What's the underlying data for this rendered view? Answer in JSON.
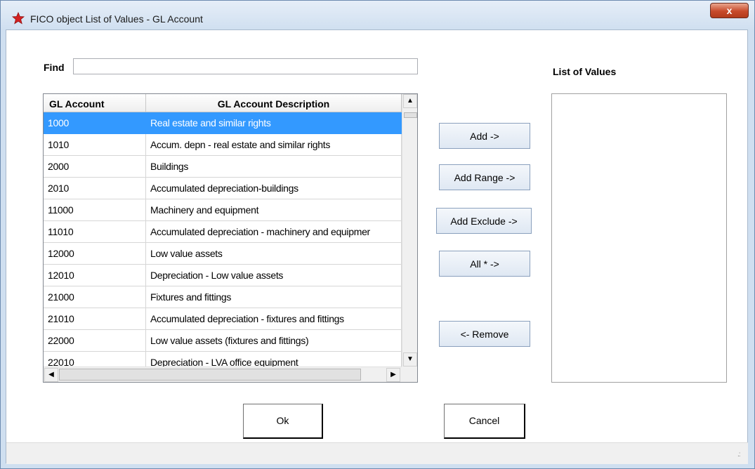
{
  "window": {
    "title": "FICO object List of Values - GL Account",
    "close_label": "x"
  },
  "find": {
    "label": "Find",
    "value": ""
  },
  "grid": {
    "columns": [
      "GL Account",
      "GL Account Description"
    ],
    "rows": [
      [
        "1000",
        "Real estate and similar rights"
      ],
      [
        "1010",
        "Accum. depn - real estate and similar rights"
      ],
      [
        "2000",
        "Buildings"
      ],
      [
        "2010",
        "Accumulated depreciation-buildings"
      ],
      [
        "11000",
        "Machinery and equipment"
      ],
      [
        "11010",
        "Accumulated depreciation - machinery and equipmer"
      ],
      [
        "12000",
        "Low value assets"
      ],
      [
        "12010",
        "Depreciation - Low value assets"
      ],
      [
        "21000",
        "Fixtures and fittings"
      ],
      [
        "21010",
        "Accumulated depreciation - fixtures and fittings"
      ],
      [
        "22000",
        "Low value assets (fixtures and fittings)"
      ],
      [
        "22010",
        "Depreciation - LVA office equipment"
      ]
    ],
    "selected_row": 0
  },
  "actions": {
    "add": "Add ->",
    "add_range": "Add Range ->",
    "add_exclude": "Add Exclude ->",
    "all": "All * ->",
    "remove": "<- Remove"
  },
  "list_of_values": {
    "label": "List of Values"
  },
  "dialog": {
    "ok": "Ok",
    "cancel": "Cancel"
  },
  "colors": {
    "selection": "#3399ff",
    "close_button": "#c74a2b"
  }
}
